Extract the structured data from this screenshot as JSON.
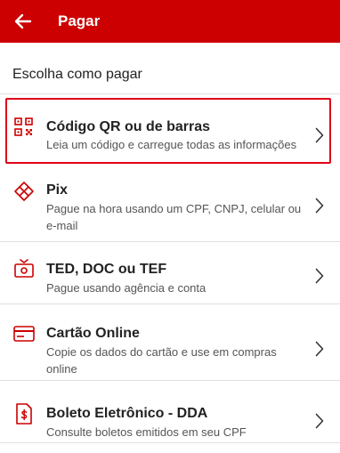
{
  "header": {
    "title": "Pagar",
    "back_icon": "arrow-left-icon",
    "accent_color": "#cc0000"
  },
  "section": {
    "title": "Escolha como pagar"
  },
  "options": [
    {
      "title": "Código QR ou de barras",
      "subtitle": "Leia um código e carregue todas as informações",
      "icon": "qr-code-icon",
      "highlighted": true
    },
    {
      "title": "Pix",
      "subtitle": "Pague na hora usando um CPF, CNPJ, celular ou e-mail",
      "icon": "pix-icon"
    },
    {
      "title": "TED, DOC ou TEF",
      "subtitle": "Pague usando agência e conta",
      "icon": "money-transfer-icon"
    },
    {
      "title": "Cartão Online",
      "subtitle": "Copie os dados do cartão e use em compras online",
      "icon": "credit-card-icon"
    },
    {
      "title": "Boleto Eletrônico - DDA",
      "subtitle": "Consulte boletos emitidos em seu CPF",
      "icon": "boleto-document-icon"
    }
  ]
}
